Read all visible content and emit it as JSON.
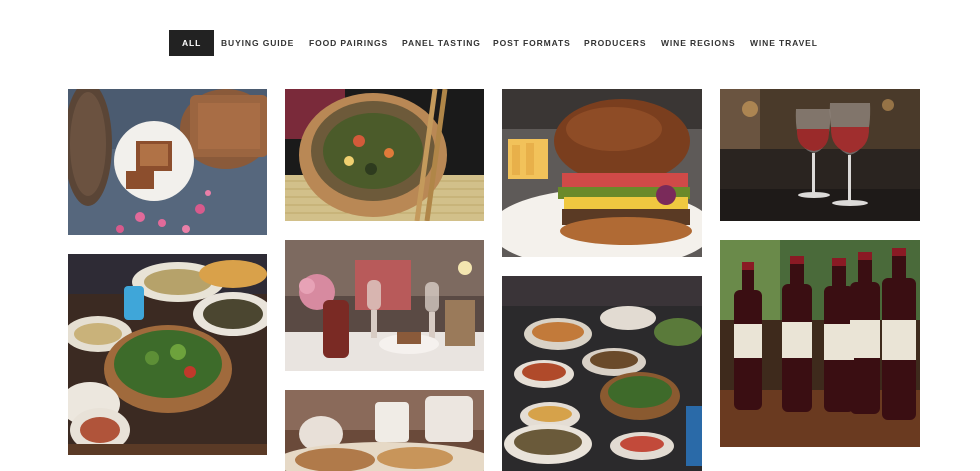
{
  "filters": {
    "items": [
      {
        "label": "All",
        "active": true
      },
      {
        "label": "Buying Guide",
        "active": false
      },
      {
        "label": "Food Pairings",
        "active": false
      },
      {
        "label": "Panel Tasting",
        "active": false
      },
      {
        "label": "Post Formats",
        "active": false
      },
      {
        "label": "Producers",
        "active": false
      },
      {
        "label": "Wine Regions",
        "active": false
      },
      {
        "label": "Wine Travel",
        "active": false
      }
    ]
  },
  "colors": {
    "active_filter_bg": "#222222",
    "active_filter_text": "#ffffff",
    "filter_text": "#333333",
    "page_bg": "#ffffff"
  },
  "gallery": {
    "photos": [
      {
        "name": "photo-pastry-tart"
      },
      {
        "name": "photo-noodle-bowl"
      },
      {
        "name": "photo-burger"
      },
      {
        "name": "photo-wine-glasses"
      },
      {
        "name": "photo-salad-spread"
      },
      {
        "name": "photo-dinner-table"
      },
      {
        "name": "photo-food-buffet"
      },
      {
        "name": "photo-wine-bottles"
      },
      {
        "name": "photo-appetizers"
      }
    ]
  }
}
